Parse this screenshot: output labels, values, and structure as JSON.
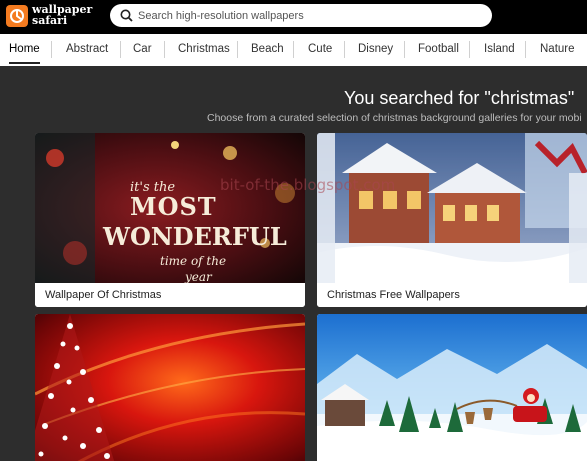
{
  "brand": {
    "line1": "wallpaper",
    "line2": "safari"
  },
  "search": {
    "placeholder": "Search high-resolution wallpapers",
    "value": ""
  },
  "nav": {
    "items": [
      {
        "label": "Home",
        "active": true
      },
      {
        "label": "Abstract"
      },
      {
        "label": "Car"
      },
      {
        "label": "Christmas"
      },
      {
        "label": "Beach"
      },
      {
        "label": "Cute"
      },
      {
        "label": "Disney"
      },
      {
        "label": "Football"
      },
      {
        "label": "Island"
      },
      {
        "label": "Nature"
      }
    ]
  },
  "results": {
    "heading": "You searched for \"christmas\"",
    "subheading": "Choose from a curated selection of christmas background galleries for your mobi"
  },
  "cards": [
    {
      "caption": "Wallpaper Of Christmas",
      "art_text": [
        "it's the",
        "MOST",
        "WONDERFUL",
        "time of the",
        "year"
      ]
    },
    {
      "caption": "Christmas Free Wallpapers"
    },
    {
      "caption": ""
    },
    {
      "caption": ""
    }
  ],
  "watermark": "bit-of-the.blogspot.com"
}
